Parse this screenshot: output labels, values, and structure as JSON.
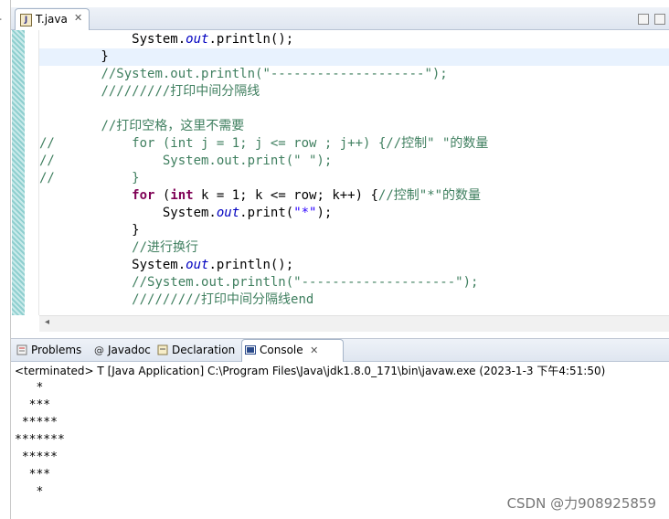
{
  "editor": {
    "tab_label": "T.java",
    "lines": [
      {
        "segments": [
          [
            "",
            "            "
          ],
          [
            "",
            "System."
          ],
          [
            "it",
            "out"
          ],
          [
            "",
            ".println();"
          ]
        ]
      },
      {
        "highlight": true,
        "segments": [
          [
            "",
            "        }"
          ]
        ]
      },
      {
        "segments": [
          [
            "",
            "        "
          ],
          [
            "cm",
            "//System.out.println(\"--------------------\");"
          ]
        ]
      },
      {
        "segments": [
          [
            "",
            "        "
          ],
          [
            "cm",
            "/////////打印中间分隔线"
          ]
        ]
      },
      {
        "segments": [
          [
            "",
            ""
          ]
        ]
      },
      {
        "segments": [
          [
            "",
            "        "
          ],
          [
            "cm",
            "//打印空格，这里不需要"
          ]
        ]
      },
      {
        "segments": [
          [
            "cm",
            "//          for (int j = 1; j <= row ; j++) {//控制\" \"的数量"
          ]
        ]
      },
      {
        "segments": [
          [
            "cm",
            "//              System.out.print(\" \");"
          ]
        ]
      },
      {
        "segments": [
          [
            "cm",
            "//          }"
          ]
        ]
      },
      {
        "segments": [
          [
            "",
            "            "
          ],
          [
            "kw",
            "for"
          ],
          [
            "",
            " ("
          ],
          [
            "kw",
            "int"
          ],
          [
            "",
            " k = 1; k <= row; k++) {"
          ],
          [
            "cm",
            "//控制\"*\"的数量"
          ]
        ]
      },
      {
        "segments": [
          [
            "",
            "                System."
          ],
          [
            "it",
            "out"
          ],
          [
            "",
            ".print("
          ],
          [
            "str",
            "\"*\""
          ],
          [
            "",
            ");"
          ]
        ]
      },
      {
        "segments": [
          [
            "",
            "            }"
          ]
        ]
      },
      {
        "segments": [
          [
            "",
            "            "
          ],
          [
            "cm",
            "//进行换行"
          ]
        ]
      },
      {
        "segments": [
          [
            "",
            "            System."
          ],
          [
            "it",
            "out"
          ],
          [
            "",
            ".println();"
          ]
        ]
      },
      {
        "segments": [
          [
            "",
            "            "
          ],
          [
            "cm",
            "//System.out.println(\"--------------------\");"
          ]
        ]
      },
      {
        "segments": [
          [
            "",
            "            "
          ],
          [
            "cm",
            "/////////打印中间分隔线end"
          ]
        ]
      }
    ]
  },
  "console_tabs": [
    {
      "label": "Problems",
      "icon": "problems-icon"
    },
    {
      "label": "Javadoc",
      "icon": "javadoc-icon"
    },
    {
      "label": "Declaration",
      "icon": "declaration-icon"
    },
    {
      "label": "Console",
      "icon": "console-icon",
      "active": true
    }
  ],
  "console": {
    "status": "<terminated> T [Java Application] C:\\Program Files\\Java\\jdk1.8.0_171\\bin\\javaw.exe (2023-1-3 下午4:51:50)",
    "output": [
      "   *",
      "  ***",
      " *****",
      "*******",
      " *****",
      "  ***",
      "   *"
    ]
  },
  "watermark": "CSDN @力908925859",
  "colors": {
    "keyword": "#7f0055",
    "field": "#0000c0",
    "string": "#2a00ff",
    "comment": "#3f7f5f"
  }
}
